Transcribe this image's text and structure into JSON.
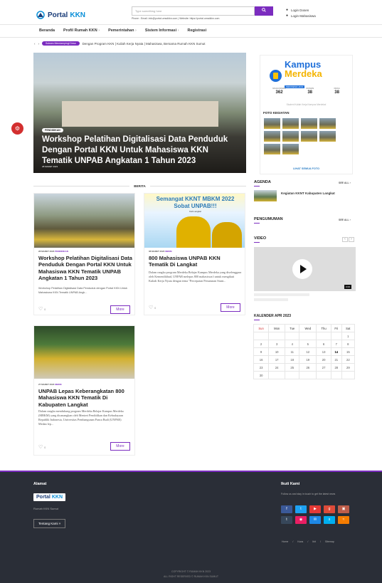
{
  "header": {
    "logo_text_a": "Portal",
    "logo_text_b": "KKN",
    "search_placeholder": "Type something here",
    "search_button": "Search",
    "contact_line": "Phone : Email: info@portal.umsdkkn.com | Website: https://portal.umsdkkn.com",
    "login_dosen": "Login Dosen",
    "login_mahasiswa": "Login Mahasiswa"
  },
  "nav": {
    "items": [
      "Beranda",
      "Profil Rumah KKN",
      "Pemerintahan",
      "Sistem Informasi",
      "Registrasi"
    ]
  },
  "breadcrumb": {
    "tag": "Sukses Mendampingi Desa",
    "text": "Dengan Program KKN | Kuliah Kerja Nyata | Mahasiswa, Bersama Rumah KKN Sumut"
  },
  "hero": {
    "category": "PENDIDIKAN",
    "title": "Workshop Pelatihan Digitalisasi Data Penduduk Dengan Portal KKN Untuk Mahasiswa KKN Tematik UNPAB Angkatan 1 Tahun 2023",
    "date": "28 MARET 2023"
  },
  "side_card": {
    "brand_a": "Kampus",
    "brand_b": "Merdeka",
    "brand_sub": "INDONESIA JAYA",
    "stats": [
      {
        "label": "MAHASISWA",
        "value": "362"
      },
      {
        "label": "DOSEN",
        "value": "38"
      },
      {
        "label": "DESA",
        "value": "38"
      }
    ],
    "description": "Student Kuliah Kerja Kampus Merdeka!",
    "gallery_title": "FOTO KEGIATAN",
    "gallery_link": "LIHAT SEMUA FOTO"
  },
  "berita": {
    "section_title": "BERITA",
    "cards": [
      {
        "date": "28 MARET 2023",
        "category": "PENDIDIKAN",
        "title": "Workshop Pelatihan Digitalisasi Data Penduduk Dengan Portal KKN Untuk Mahasiswa KKN Tematik UNPAB Angkatan 1 Tahun 2023",
        "excerpt": "Workshop Pelatihan Digitalisasi Data Penduduk dengan Portal KKN Untuk Mahasiswa KKN Tematik UNPAB Angk...",
        "likes": "0",
        "more": "More"
      },
      {
        "date": "08 MARET 2023",
        "category": "MBKM",
        "banner_line1": "Semangat KKNT MBKM 2022",
        "banner_line2": "Sobat UNPAB!!!",
        "banner_line3": "Kab Langkat",
        "title": "800 Mahasiswa UNPAB KKN Tematik Di Langkat",
        "excerpt": "Dalam rangka program Merdeka Belajar Kampus Merdeka yang diselenggara oleh Kemendikbud, UNPAB melepas 800 mahasiswa/i untuk mengikuti Kuliah Kerja Nyata dengan tema \"Percepatan Penurunan Stunt...",
        "likes": "0",
        "more": "More"
      },
      {
        "date": "27 MARET 2023",
        "category": "MBKM",
        "title": "UNPAB Lepas Keberangkatan 800 Mahasiswa KKN Tematik Di Kabupaten Langkat",
        "excerpt": "Dalam rangka mendukung program Merdeka Belajar Kampus Merdeka (MBKM) yang dicanangkan oleh Menteri Pendidikan dan Kebudayaan Republik Indonesia, Universitas Pembangunan Panca Budi (UNPAB) Medan lep...",
        "likes": "0",
        "more": "More"
      }
    ]
  },
  "agenda": {
    "title": "AGENDA",
    "see_all": "SEE ALL",
    "item": "Kegiatan KKNT Kabupaten Langkat"
  },
  "pengumuman": {
    "title": "PENGUMUMAN",
    "see_all": "SEE ALL"
  },
  "video": {
    "title": "VIDEO",
    "duration": "0:00"
  },
  "calendar": {
    "title": "KALENDER APR 2023",
    "days": [
      "Sun",
      "Mon",
      "Tue",
      "Wed",
      "Thu",
      "Fri",
      "Sat"
    ],
    "weeks": [
      [
        "",
        "",
        "",
        "",
        "",
        "",
        "1"
      ],
      [
        "2",
        "3",
        "4",
        "5",
        "6",
        "7",
        "8"
      ],
      [
        "9",
        "10",
        "11",
        "12",
        "13",
        "14",
        "15"
      ],
      [
        "16",
        "17",
        "18",
        "19",
        "20",
        "21",
        "22"
      ],
      [
        "23",
        "24",
        "25",
        "26",
        "27",
        "28",
        "29"
      ],
      [
        "30",
        "",
        "",
        "",
        "",
        "",
        ""
      ]
    ],
    "today": "14"
  },
  "footer": {
    "alamat_title": "Alamat",
    "logo_a": "Portal",
    "logo_b": "KKN",
    "address": "Rumah KKN Sumut",
    "about_button": "Tentang Kami",
    "follow_title": "Ikuti Kami",
    "follow_text": "Follow us and stay in touch to get the latest news",
    "links": [
      "Home",
      "Kaos",
      "Ibit",
      "Sitemap"
    ],
    "copyright": "COPYRIGHT © RUMAH KKN 2023",
    "rights": "ALL RIGHT RESERVED © RUMAH KKN SUMUT"
  },
  "colors": {
    "accent": "#7b2cbf",
    "footer_bg": "#2a2e37",
    "fab": "#d32f2f"
  }
}
